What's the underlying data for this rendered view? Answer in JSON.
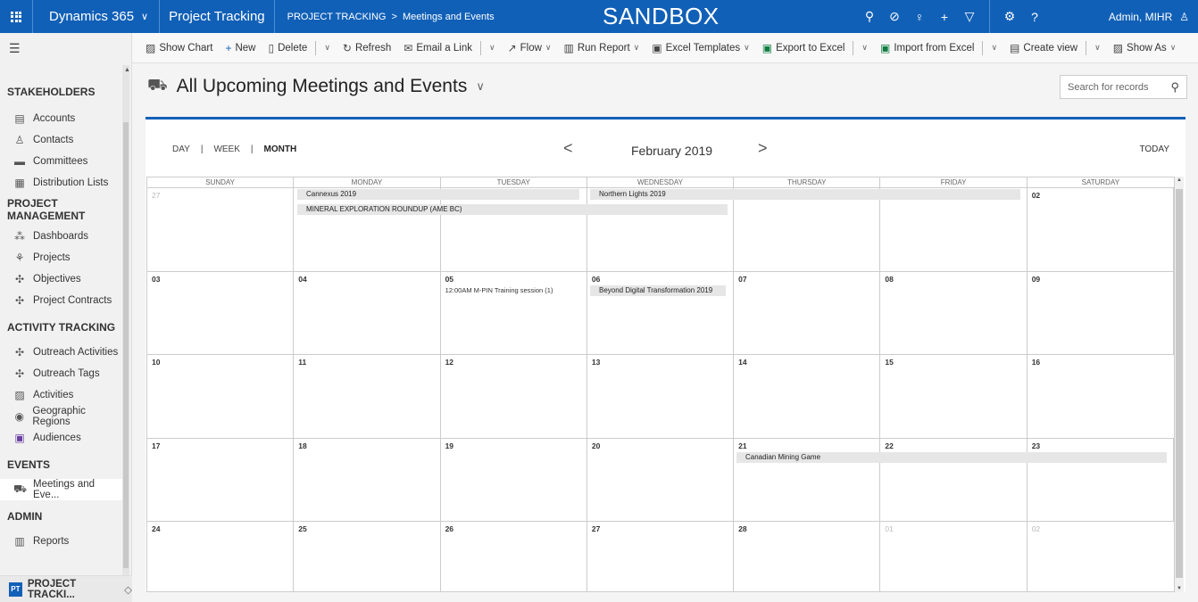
{
  "topbar": {
    "brand": "Dynamics 365",
    "app_name": "Project Tracking",
    "breadcrumb_root": "PROJECT TRACKING",
    "breadcrumb_separator": ">",
    "breadcrumb_page": "Meetings and Events",
    "environment_label": "SANDBOX",
    "user_name": "Admin, MIHR",
    "icons": [
      "search-icon",
      "activity-icon",
      "lightbulb-icon",
      "plus-icon",
      "filter-icon",
      "gear-icon",
      "help-icon"
    ]
  },
  "commands": {
    "show_chart": "Show Chart",
    "new": "New",
    "delete": "Delete",
    "refresh": "Refresh",
    "email_link": "Email a Link",
    "flow": "Flow",
    "run_report": "Run Report",
    "excel_templates": "Excel Templates",
    "export_excel": "Export to Excel",
    "import_excel": "Import from Excel",
    "create_view": "Create view",
    "show_as": "Show As"
  },
  "sidebar": {
    "sections": [
      {
        "title": "STAKEHOLDERS",
        "items": [
          "Accounts",
          "Contacts",
          "Committees",
          "Distribution Lists"
        ]
      },
      {
        "title": "PROJECT MANAGEMENT",
        "items": [
          "Dashboards",
          "Projects",
          "Objectives",
          "Project Contracts"
        ]
      },
      {
        "title": "ACTIVITY TRACKING",
        "items": [
          "Outreach Activities",
          "Outreach Tags",
          "Activities",
          "Geographic Regions",
          "Audiences"
        ]
      },
      {
        "title": "EVENTS",
        "items": [
          "Meetings and Eve..."
        ]
      },
      {
        "title": "ADMIN",
        "items": [
          "Reports"
        ]
      }
    ],
    "area_badge": "PT",
    "area_label": "PROJECT TRACKI..."
  },
  "view": {
    "title": "All Upcoming Meetings and Events",
    "search_placeholder": "Search for records"
  },
  "calendar": {
    "modes": [
      "DAY",
      "WEEK",
      "MONTH"
    ],
    "selected_mode": "MONTH",
    "month_label": "February 2019",
    "today_label": "TODAY",
    "weekdays": [
      "SUNDAY",
      "MONDAY",
      "TUESDAY",
      "WEDNESDAY",
      "THURSDAY",
      "FRIDAY",
      "SATURDAY"
    ],
    "weeks": [
      [
        "27",
        "",
        "",
        "",
        "",
        "",
        "02"
      ],
      [
        "03",
        "04",
        "05",
        "06",
        "07",
        "08",
        "09"
      ],
      [
        "10",
        "11",
        "12",
        "13",
        "14",
        "15",
        "16"
      ],
      [
        "17",
        "18",
        "19",
        "20",
        "21",
        "22",
        "23"
      ],
      [
        "24",
        "25",
        "26",
        "27",
        "28",
        "01",
        "02"
      ]
    ],
    "events": {
      "cannexus": "Cannexus 2019",
      "northern_lights": "Northern Lights 2019",
      "mineral": "MINERAL EXPLORATION ROUNDUP (AME BC)",
      "mpin": "12:00AM M-PIN Training session (1)",
      "beyond": "Beyond Digital Transformation 2019",
      "mining_game": "Canadian Mining Game"
    }
  }
}
